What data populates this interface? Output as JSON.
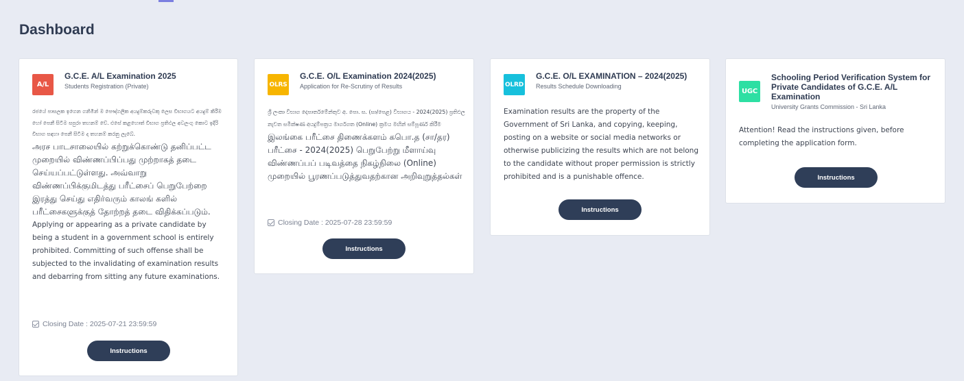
{
  "page": {
    "title": "Dashboard"
  },
  "colors": {
    "badge_red": "#e85746",
    "badge_yellow": "#f7b500",
    "badge_cyan": "#17c0dc",
    "badge_green": "#2ddfa3",
    "button": "#2f3e58",
    "background": "#e8ebf3"
  },
  "cards": [
    {
      "badge": "A/L",
      "title": "G.C.E. A/L Examination 2025",
      "subtitle": "Students Registration (Private)",
      "body_sinhala": "රජයේ පාසලක ඉගෙන ගනිමින් ම පෞද්ගලික අයදුම්කරුවකු ලෙස විභාගයට අයදුම් කිරීම හෝ පෙනී සිටීම සපුරා තහනම් වේ. එසේ කළහොත් විභාග ප්‍රතිඵල අවලංගු කොට ඉදිරි විභාග සඳහා පෙනී සිටීම ද තහනම් කරනු ලැබේ.",
      "body_tamil": "அரச பாடசாலையில் கற்றுக்கொண்டு தனிப்பட்ட முறையில் விண்ணப்பிப்பது முற்றாகத் தடை செய்யப்பட்டுள்ளது. அவ்வாறு விண்ணப்பிக்குமிடத்து பரீட்சைப் பெறுபேற்றை இரத்து செய்து எதிர்வரும் காலங் களில் பரீட்சைகளுக்குத் தோற்றத் தடை விதிக்கப்படும்.",
      "body_english": "Applying or appearing as a private candidate by being a student in a government school is entirely prohibited. Committing of such offense shall be subjected to the invalidating of examination results and debarring from sitting any future examinations.",
      "closing": "Closing Date : 2025-07-21 23:59:59",
      "button": "Instructions"
    },
    {
      "badge": "OLRS",
      "title": "G.C.E. O/L Examination 2024(2025)",
      "subtitle": "Application for Re-Scrutiny of Results",
      "body_sinhala": "ශ්‍රී ලංකා විභාග දෙපාර්තමේන්තුව අ. පො. ස. (සා/පෙළ) විභාගය - 2024(2025) ප්‍රතිඵල නැවත සමීක්ෂණ අයදුම්පත්‍රය මාර්ගගත (Online) ක්‍රමය මඟින් සම්පූර්ණ කිරීම",
      "body_tamil": "இலங்கை பரீட்சை திணைக்களம் கபொ.த (சா/தர) பரீட்சை - 2024(2025) பெறுபேற்று மீளாய்வு விண்ணப்பப் படிவத்தை நிகழ்நிலை (Online) முறையில் பூரணப்படுத்துவதற்கான அறிவுறுத்தல்கள்",
      "closing": "Closing Date : 2025-07-28 23:59:59",
      "button": "Instructions"
    },
    {
      "badge": "OLRD",
      "title": "G.C.E. O/L EXAMINATION – 2024(2025)",
      "subtitle": "Results Schedule Downloading",
      "body_english": "Examination results are the property of the Government of Sri Lanka, and copying, keeping, posting on a website or social media networks or otherwise publicizing the results which are not belong to the candidate without proper permission is strictly prohibited and is a punishable offence.",
      "button": "Instructions"
    },
    {
      "badge": "UGC",
      "title": "Schooling Period Verification System for Private Candidates of G.C.E. A/L Examination",
      "subtitle": "University Grants Commission - Sri Lanka",
      "body_english": "Attention! Read the instructions given, before completing the application form.",
      "button": "Instructions"
    }
  ]
}
